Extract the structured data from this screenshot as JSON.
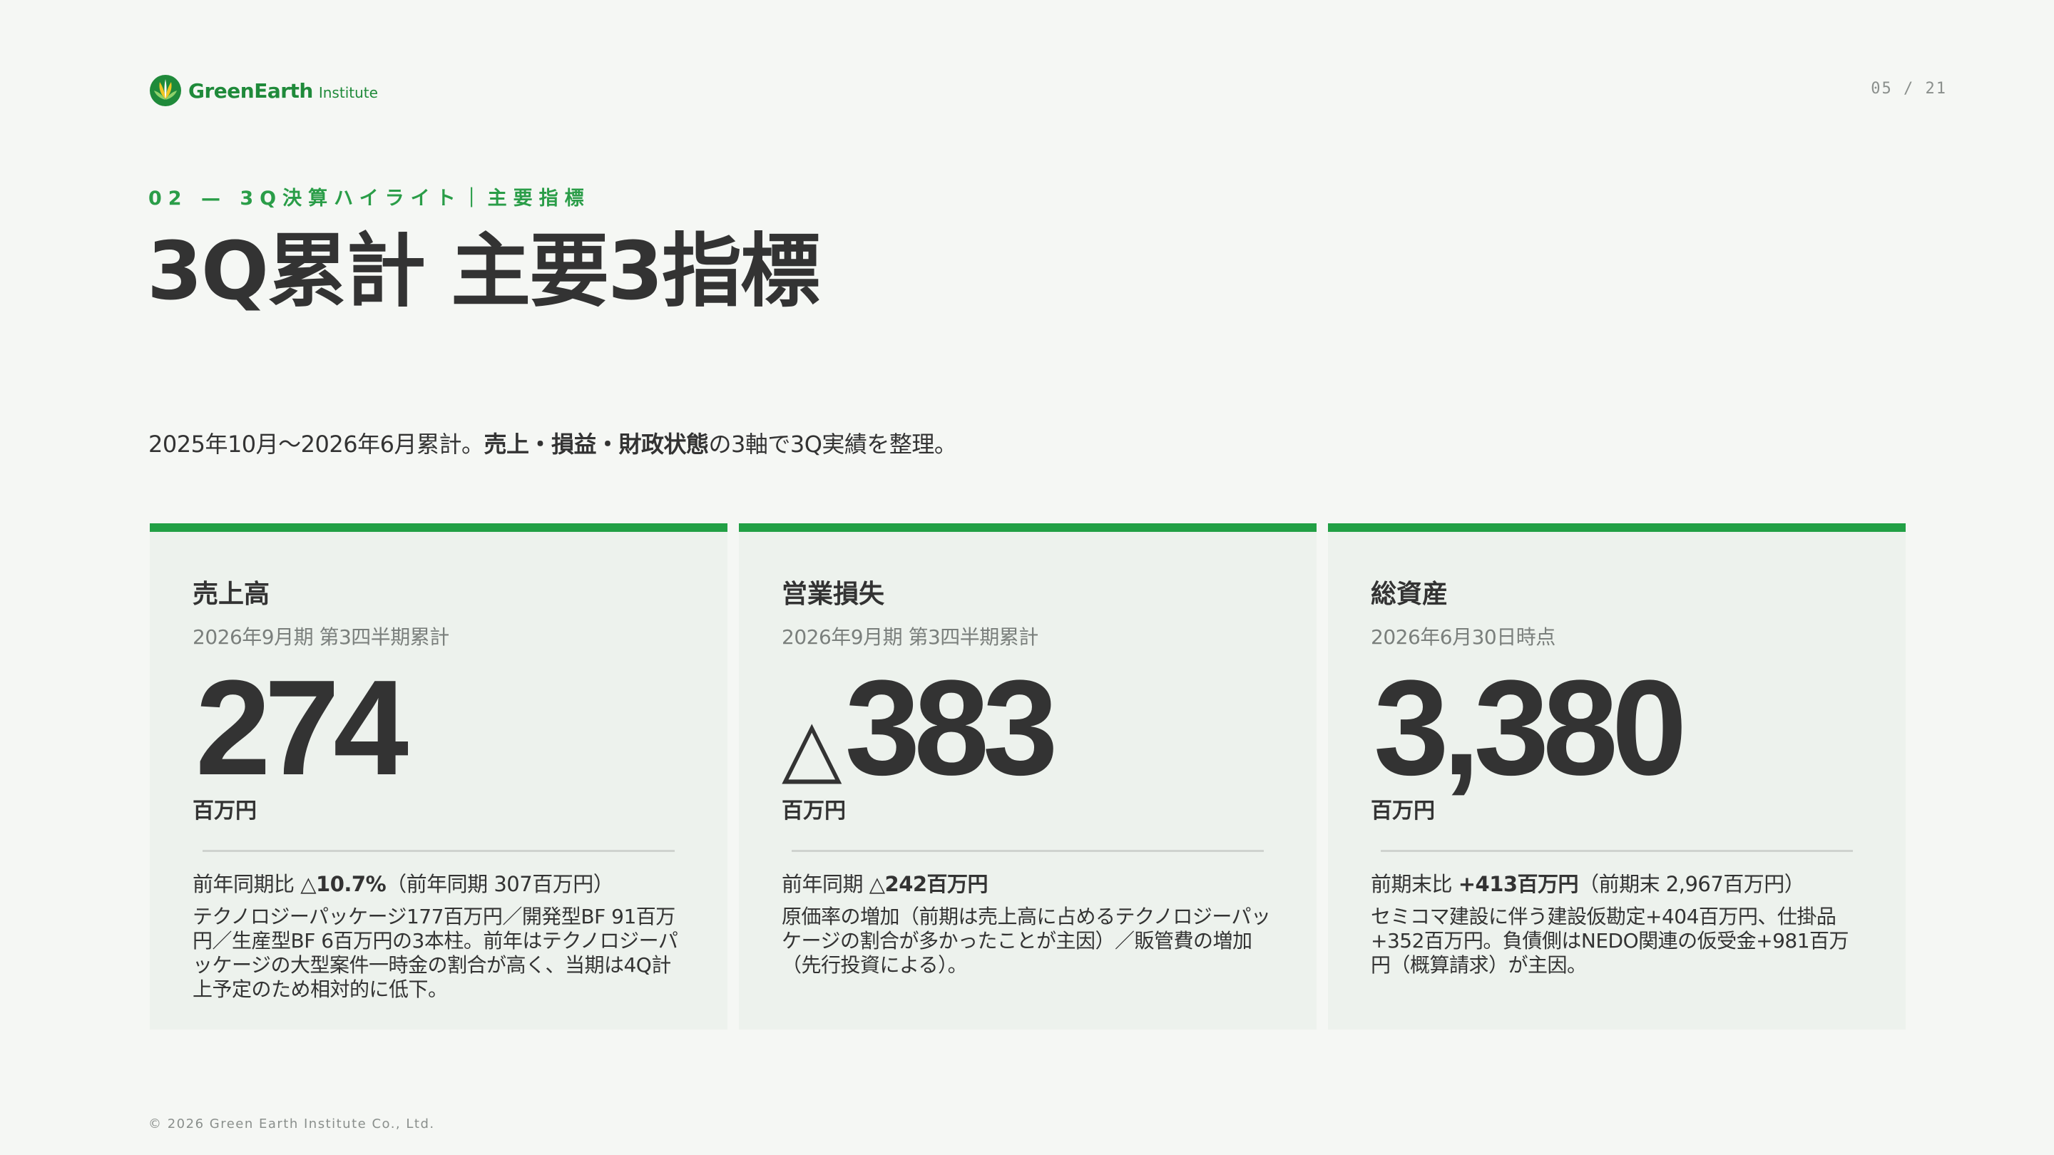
{
  "header": {
    "logo_text_main": "GreenEarth",
    "logo_text_sub": "Institute",
    "page_number": "05 / 21"
  },
  "section_label": "02 — 3Q決算ハイライト｜主要指標",
  "title": "3Q累計 主要3指標",
  "lead": {
    "before": "2025年10月〜2026年6月累計。",
    "bold": "売上・損益・財政状態",
    "after": "の3軸で3Q実績を整理。"
  },
  "cards": [
    {
      "title": "売上高",
      "period": "2026年9月期 第3四半期累計",
      "prefix": "",
      "value": "274",
      "unit": "百万円",
      "compare_label": "前年同期比 ",
      "compare_bold": "△10.7%",
      "compare_rest": "（前年同期 307百万円）",
      "note": "テクノロジーパッケージ177百万円／開発型BF 91百万円／生産型BF 6百万円の3本柱。前年はテクノロジーパッケージの大型案件一時金の割合が高く、当期は4Q計上予定のため相対的に低下。"
    },
    {
      "title": "営業損失",
      "period": "2026年9月期 第3四半期累計",
      "prefix": "△",
      "value": "383",
      "unit": "百万円",
      "compare_label": "前年同期 ",
      "compare_bold": "△242百万円",
      "compare_rest": "",
      "note": "原価率の増加（前期は売上高に占めるテクノロジーパッケージの割合が多かったことが主因）／販管費の増加（先行投資による）。"
    },
    {
      "title": "総資産",
      "period": "2026年6月30日時点",
      "prefix": "",
      "value": "3,380",
      "unit": "百万円",
      "compare_label": "前期末比 ",
      "compare_bold": "+413百万円",
      "compare_rest": "（前期末 2,967百万円）",
      "note": "セミコマ建設に伴う建設仮勘定+404百万円、仕掛品+352百万円。負債側はNEDO関連の仮受金+981百万円（概算請求）が主因。"
    }
  ],
  "footer": "© 2026 Green Earth Institute Co., Ltd.",
  "colors": {
    "accent": "#22a045",
    "background": "#f5f7f4",
    "card_background": "#edf2ed",
    "text": "#333333"
  },
  "icons": {
    "logo": "leaf-logo-icon"
  }
}
